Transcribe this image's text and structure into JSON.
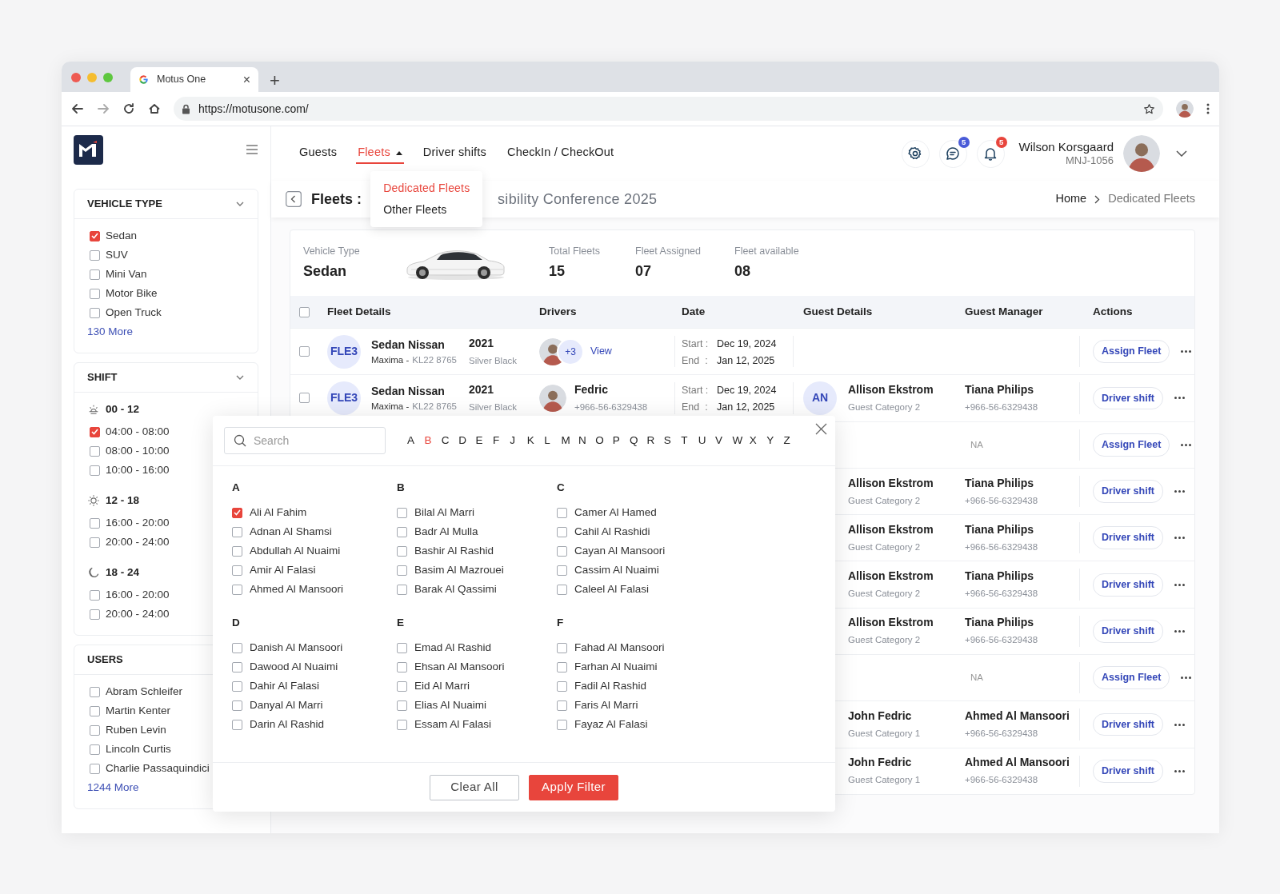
{
  "browser": {
    "tab_title": "Motus One",
    "tab_close": "×",
    "new_tab": "+",
    "url": "https://motusone.com/"
  },
  "sidebar": {
    "sections": [
      {
        "title": "VEHICLE TYPE",
        "groups": [
          {
            "items": [
              {
                "label": "Sedan",
                "checked": true
              },
              {
                "label": "SUV",
                "checked": false
              },
              {
                "label": "Mini Van",
                "checked": false
              },
              {
                "label": "Motor Bike",
                "checked": false
              },
              {
                "label": "Open Truck",
                "checked": false
              }
            ]
          }
        ],
        "more": "130 More"
      },
      {
        "title": "SHIFT",
        "groups": [
          {
            "kind": "sunrise",
            "label": "00 - 12",
            "items": [
              {
                "label": "04:00 - 08:00",
                "checked": true
              },
              {
                "label": "08:00 - 10:00",
                "checked": false
              },
              {
                "label": "10:00 - 16:00",
                "checked": false
              }
            ]
          },
          {
            "kind": "sun",
            "label": "12 - 18",
            "items": [
              {
                "label": "16:00 - 20:00",
                "checked": false
              },
              {
                "label": "20:00 - 24:00",
                "checked": false
              }
            ]
          },
          {
            "kind": "moon",
            "label": "18 - 24",
            "items": [
              {
                "label": "16:00 - 20:00",
                "checked": false
              },
              {
                "label": "20:00 - 24:00",
                "checked": false
              }
            ]
          }
        ]
      },
      {
        "title": "USERS",
        "groups": [
          {
            "items": [
              {
                "label": "Abram Schleifer",
                "checked": false
              },
              {
                "label": "Martin Kenter",
                "checked": false
              },
              {
                "label": "Ruben Levin",
                "checked": false
              },
              {
                "label": "Lincoln Curtis",
                "checked": false
              },
              {
                "label": "Charlie Passaquindici",
                "checked": false
              }
            ]
          }
        ],
        "more": "1244 More"
      }
    ]
  },
  "nav": {
    "items": [
      {
        "label": "Guests",
        "selected": false
      },
      {
        "label": "Fleets",
        "selected": true,
        "expanded": true,
        "menu": [
          {
            "label": "Dedicated Fleets",
            "selected": true
          },
          {
            "label": "Other Fleets",
            "selected": false
          }
        ]
      },
      {
        "label": "Driver shifts",
        "selected": false
      },
      {
        "label": "CheckIn / CheckOut",
        "selected": false
      }
    ]
  },
  "header": {
    "buttons": [
      {
        "kind": "settings"
      },
      {
        "kind": "chat",
        "count": "5",
        "color": "#4a5bd8"
      },
      {
        "kind": "bell",
        "count": "5",
        "color": "#e8453c"
      }
    ],
    "user": {
      "name": "Wilson Korsgaard",
      "id": "MNJ-1056"
    }
  },
  "page": {
    "title": "Fleets :",
    "title_rest": "sibility Conference 2025",
    "breadcrumb": [
      {
        "label": "Home",
        "selected": false
      },
      {
        "label": "Dedicated Fleets",
        "selected": true
      }
    ]
  },
  "summary": {
    "label": "Vehicle Type",
    "value": "Sedan",
    "stats": [
      {
        "label": "Total Fleets",
        "value": "15"
      },
      {
        "label": "Fleet Assigned",
        "value": "07"
      },
      {
        "label": "Fleet available",
        "value": "08"
      }
    ]
  },
  "table": {
    "all_checked": false,
    "columns": [
      "Fleet Details",
      "Drivers",
      "Date",
      "Guest Details",
      "Guest Manager",
      "Actions"
    ],
    "rows": [
      {
        "checked": false,
        "fleet": {
          "code": "FLE3",
          "name": "Sedan Nissan",
          "model": "Maxima -",
          "plate": "KL22 8765",
          "year": "2021",
          "finish": "Silver Black"
        },
        "drivers": {
          "kind": "group",
          "more": "+3",
          "link": "View"
        },
        "date": {
          "start_label": "Start :",
          "start": "Dec 19, 2024",
          "end_label": "End  :",
          "end": "Jan 12, 2025"
        },
        "action": "Assign Fleet"
      },
      {
        "checked": false,
        "fleet": {
          "code": "FLE3",
          "name": "Sedan Nissan",
          "model": "Maxima -",
          "plate": "KL22 8765",
          "year": "2021",
          "finish": "Silver Black"
        },
        "drivers": {
          "kind": "single",
          "name": "Fedric",
          "phone": "+966-56-6329438"
        },
        "date": {
          "start_label": "Start :",
          "start": "Dec 19, 2024",
          "end_label": "End  :",
          "end": "Jan 12, 2025"
        },
        "guest": {
          "initials": "AN",
          "name": "Allison Ekstrom",
          "category": "Guest Category 2"
        },
        "manager": {
          "name": "Tiana Philips",
          "phone": "+966-56-6329438"
        },
        "action": "Driver shift"
      },
      {
        "note": "NA",
        "action": "Assign Fleet"
      },
      {
        "guest": {
          "name": "Allison Ekstrom",
          "category": "Guest Category 2"
        },
        "manager": {
          "name": "Tiana Philips",
          "phone": "+966-56-6329438"
        },
        "action": "Driver shift"
      },
      {
        "guest": {
          "name": "Allison Ekstrom",
          "category": "Guest Category 2"
        },
        "manager": {
          "name": "Tiana Philips",
          "phone": "+966-56-6329438"
        },
        "action": "Driver shift"
      },
      {
        "guest": {
          "name": "Allison Ekstrom",
          "category": "Guest Category 2"
        },
        "manager": {
          "name": "Tiana Philips",
          "phone": "+966-56-6329438"
        },
        "action": "Driver shift"
      },
      {
        "guest": {
          "name": "Allison Ekstrom",
          "category": "Guest Category 2"
        },
        "manager": {
          "name": "Tiana Philips",
          "phone": "+966-56-6329438"
        },
        "action": "Driver shift"
      },
      {
        "note": "NA",
        "action": "Assign Fleet"
      },
      {
        "guest": {
          "name": "John Fedric",
          "category": "Guest Category 1"
        },
        "manager": {
          "name": "Ahmed Al Mansoori",
          "phone": "+966-56-6329438"
        },
        "action": "Driver shift"
      },
      {
        "guest": {
          "name": "John Fedric",
          "category": "Guest Category 1"
        },
        "manager": {
          "name": "Ahmed Al Mansoori",
          "phone": "+966-56-6329438"
        },
        "action": "Driver shift"
      }
    ]
  },
  "filter": {
    "search_placeholder": "Search",
    "letters": [
      {
        "label": "A",
        "selected": false
      },
      {
        "label": "B",
        "selected": true
      },
      {
        "label": "C",
        "selected": false
      },
      {
        "label": "D",
        "selected": false
      },
      {
        "label": "E",
        "selected": false
      },
      {
        "label": "F",
        "selected": false
      },
      {
        "label": "J",
        "selected": false
      },
      {
        "label": "K",
        "selected": false
      },
      {
        "label": "L",
        "selected": false
      },
      {
        "label": "M",
        "selected": false
      },
      {
        "label": "N",
        "selected": false
      },
      {
        "label": "O",
        "selected": false
      },
      {
        "label": "P",
        "selected": false
      },
      {
        "label": "Q",
        "selected": false
      },
      {
        "label": "R",
        "selected": false
      },
      {
        "label": "S",
        "selected": false
      },
      {
        "label": "T",
        "selected": false
      },
      {
        "label": "U",
        "selected": false
      },
      {
        "label": "V",
        "selected": false
      },
      {
        "label": "W",
        "selected": false
      },
      {
        "label": "X",
        "selected": false
      },
      {
        "label": "Y",
        "selected": false
      },
      {
        "label": "Z",
        "selected": false
      }
    ],
    "groups": [
      {
        "letter": "A",
        "items": [
          {
            "label": "Ali Al Fahim",
            "checked": true
          },
          {
            "label": "Adnan Al Shamsi",
            "checked": false
          },
          {
            "label": "Abdullah Al Nuaimi",
            "checked": false
          },
          {
            "label": "Amir Al Falasi",
            "checked": false
          },
          {
            "label": "Ahmed Al Mansoori",
            "checked": false
          }
        ]
      },
      {
        "letter": "B",
        "items": [
          {
            "label": "Bilal Al Marri",
            "checked": false
          },
          {
            "label": "Badr Al Mulla",
            "checked": false
          },
          {
            "label": "Bashir Al Rashid",
            "checked": false
          },
          {
            "label": "Basim Al Mazrouei",
            "checked": false
          },
          {
            "label": "Barak Al Qassimi",
            "checked": false
          }
        ]
      },
      {
        "letter": "C",
        "items": [
          {
            "label": "Camer Al Hamed",
            "checked": false
          },
          {
            "label": "Cahil Al Rashidi",
            "checked": false
          },
          {
            "label": "Cayan Al Mansoori",
            "checked": false
          },
          {
            "label": "Cassim Al Nuaimi",
            "checked": false
          },
          {
            "label": "Caleel Al Falasi",
            "checked": false
          }
        ]
      },
      {
        "letter": "D",
        "items": [
          {
            "label": "Danish Al Mansoori",
            "checked": false
          },
          {
            "label": "Dawood Al Nuaimi",
            "checked": false
          },
          {
            "label": "Dahir Al Falasi",
            "checked": false
          },
          {
            "label": "Danyal Al Marri",
            "checked": false
          },
          {
            "label": "Darin Al Rashid",
            "checked": false
          }
        ]
      },
      {
        "letter": "E",
        "items": [
          {
            "label": "Emad Al Rashid",
            "checked": false
          },
          {
            "label": "Ehsan Al Mansoori",
            "checked": false
          },
          {
            "label": "Eid Al Marri",
            "checked": false
          },
          {
            "label": "Elias Al Nuaimi",
            "checked": false
          },
          {
            "label": "Essam Al Falasi",
            "checked": false
          }
        ]
      },
      {
        "letter": "F",
        "items": [
          {
            "label": "Fahad Al Mansoori",
            "checked": false
          },
          {
            "label": "Farhan Al Nuaimi",
            "checked": false
          },
          {
            "label": "Fadil Al Rashid",
            "checked": false
          },
          {
            "label": "Faris Al Marri",
            "checked": false
          },
          {
            "label": "Fayaz Al Falasi",
            "checked": false
          }
        ]
      }
    ],
    "buttons": [
      {
        "label": "Clear All",
        "kind": "secondary"
      },
      {
        "label": "Apply Filter",
        "kind": "primary"
      }
    ]
  }
}
